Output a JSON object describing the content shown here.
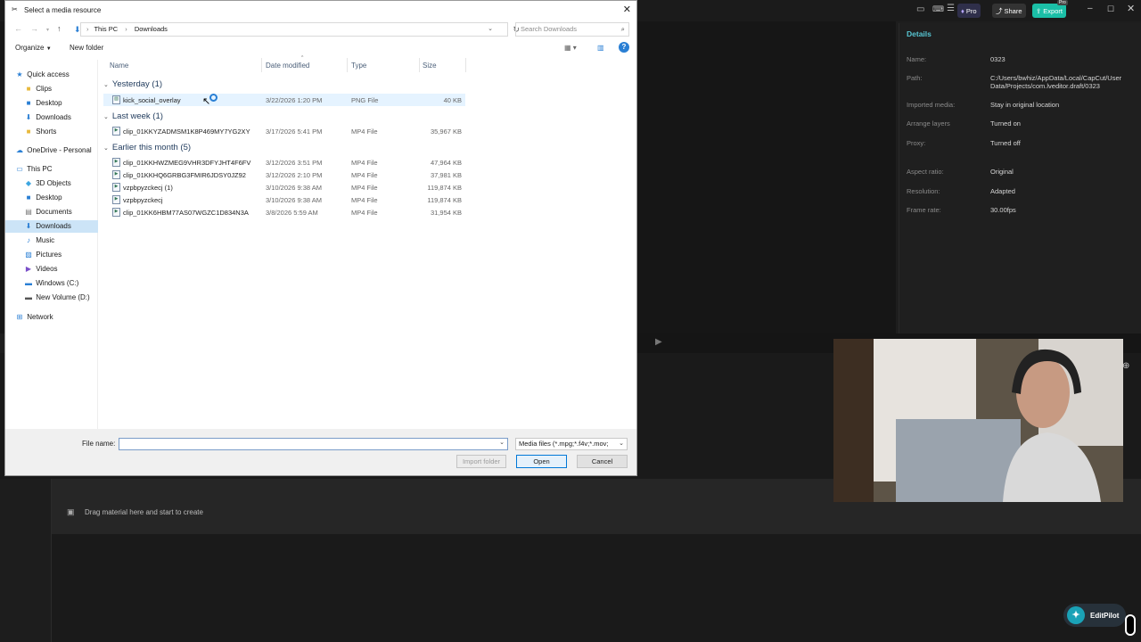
{
  "app": {
    "header": {
      "pro_label": "Pro",
      "share_label": "Share",
      "export_label": "Export",
      "export_badge": "Pro"
    },
    "details": {
      "title": "Details",
      "rows": [
        {
          "key": "Name:",
          "value": "0323"
        },
        {
          "key": "Path:",
          "value": "C:/Users/bwhiz/AppData/Local/CapCut/User Data/Projects/com.lveditor.draft/0323"
        },
        {
          "key": "Imported media:",
          "value": "Stay in original location"
        },
        {
          "key": "Arrange layers",
          "value": "Turned on"
        },
        {
          "key": "Proxy:",
          "value": "Turned off"
        },
        {
          "key": "Aspect ratio:",
          "value": "Original"
        },
        {
          "key": "Resolution:",
          "value": "Adapted"
        },
        {
          "key": "Frame rate:",
          "value": "30.00fps"
        }
      ]
    },
    "timeline": {
      "hint": "Drag material here and start to create"
    },
    "assistant": {
      "label": "EditPilot"
    }
  },
  "dialog": {
    "title": "Select a media resource",
    "breadcrumb": [
      "This PC",
      "Downloads"
    ],
    "search_placeholder": "Search Downloads",
    "toolbar": {
      "organize": "Organize",
      "new_folder": "New folder"
    },
    "nav_items": [
      {
        "label": "Quick access",
        "icon": "star-icon"
      },
      {
        "label": "Clips",
        "icon": "folder-icon"
      },
      {
        "label": "Desktop",
        "icon": "desktop-icon"
      },
      {
        "label": "Downloads",
        "icon": "download-icon"
      },
      {
        "label": "Shorts",
        "icon": "folder-icon"
      },
      {
        "label": "OneDrive - Personal",
        "icon": "cloud-icon"
      },
      {
        "label": "This PC",
        "icon": "computer-icon"
      },
      {
        "label": "3D Objects",
        "icon": "cube-icon"
      },
      {
        "label": "Desktop",
        "icon": "desktop-icon"
      },
      {
        "label": "Documents",
        "icon": "document-icon"
      },
      {
        "label": "Downloads",
        "icon": "download-icon"
      },
      {
        "label": "Music",
        "icon": "music-icon"
      },
      {
        "label": "Pictures",
        "icon": "picture-icon"
      },
      {
        "label": "Videos",
        "icon": "video-icon"
      },
      {
        "label": "Windows (C:)",
        "icon": "drive-icon"
      },
      {
        "label": "New Volume (D:)",
        "icon": "drive-icon"
      },
      {
        "label": "Network",
        "icon": "network-icon"
      }
    ],
    "columns": {
      "name": "Name",
      "date": "Date modified",
      "type": "Type",
      "size": "Size"
    },
    "groups": [
      {
        "label": "Yesterday (1)",
        "files": [
          {
            "name": "kick_social_overlay",
            "date": "3/22/2026 1:20 PM",
            "type": "PNG File",
            "size": "40 KB"
          }
        ]
      },
      {
        "label": "Last week (1)",
        "files": [
          {
            "name": "clip_01KKYZADMSM1K8P469MY7YG2XY",
            "date": "3/17/2026 5:41 PM",
            "type": "MP4 File",
            "size": "35,967 KB"
          }
        ]
      },
      {
        "label": "Earlier this month (5)",
        "files": [
          {
            "name": "clip_01KKHWZMEG9VHR3DFYJHT4F6FV",
            "date": "3/12/2026 3:51 PM",
            "type": "MP4 File",
            "size": "47,964 KB"
          },
          {
            "name": "clip_01KKHQ6GRBG3FMIR6JDSY0JZ92",
            "date": "3/12/2026 2:10 PM",
            "type": "MP4 File",
            "size": "37,981 KB"
          },
          {
            "name": "vzpbpyzckecj (1)",
            "date": "3/10/2026 9:38 AM",
            "type": "MP4 File",
            "size": "119,874 KB"
          },
          {
            "name": "vzpbpyzckecj",
            "date": "3/10/2026 9:38 AM",
            "type": "MP4 File",
            "size": "119,874 KB"
          },
          {
            "name": "clip_01KK6HBM77AS07WGZC1D834N3A",
            "date": "3/8/2026 5:59 AM",
            "type": "MP4 File",
            "size": "31,954 KB"
          }
        ]
      }
    ],
    "file_name_label": "File name:",
    "file_name_value": "",
    "filter_value": "Media files (*.mpg;*.f4v;*.mov;",
    "buttons": {
      "import_folder": "Import folder",
      "open": "Open",
      "cancel": "Cancel"
    }
  },
  "colors": {
    "accent": "#57c6d3",
    "selection": "#cce4f7",
    "primary_border": "#0078d7"
  }
}
